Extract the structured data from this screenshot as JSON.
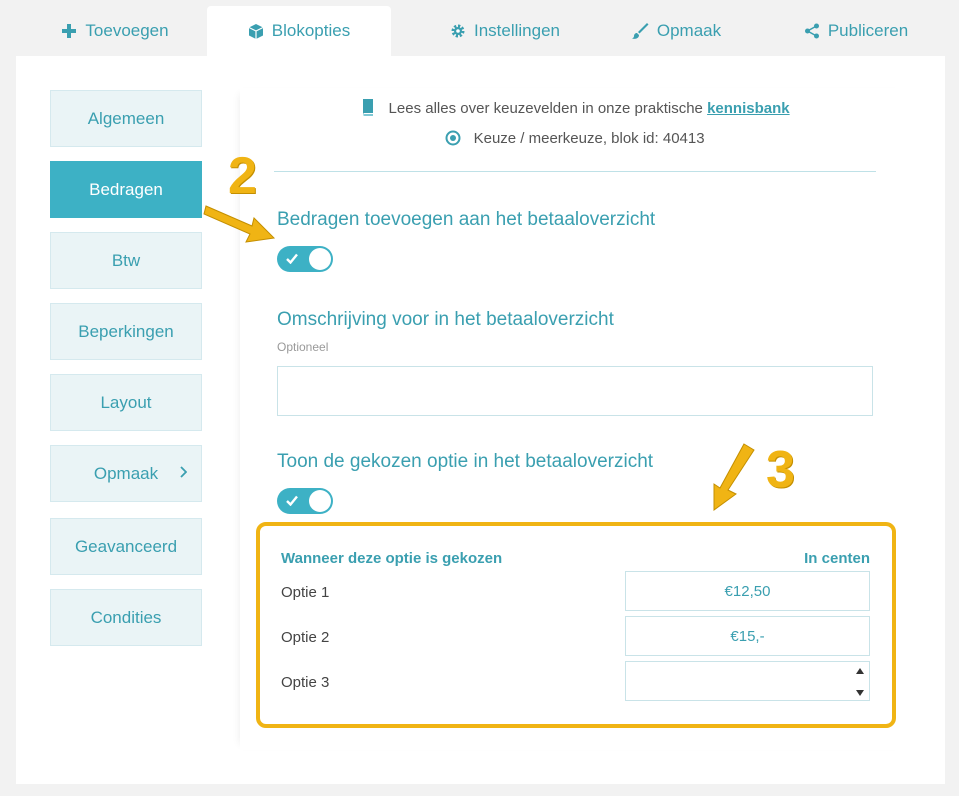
{
  "tabs": [
    {
      "label": "Toevoegen",
      "icon": "plus-icon"
    },
    {
      "label": "Blokopties",
      "icon": "cube-icon",
      "active": true
    },
    {
      "label": "Instellingen",
      "icon": "gear-icon"
    },
    {
      "label": "Opmaak",
      "icon": "brush-icon"
    },
    {
      "label": "Publiceren",
      "icon": "share-icon"
    }
  ],
  "sidebar": {
    "items": [
      {
        "label": "Algemeen"
      },
      {
        "label": "Bedragen",
        "active": true
      },
      {
        "label": "Btw"
      },
      {
        "label": "Beperkingen"
      },
      {
        "label": "Layout"
      },
      {
        "label": "Opmaak",
        "has_submenu": true
      },
      {
        "label": "Geavanceerd"
      },
      {
        "label": "Condities"
      }
    ]
  },
  "info": {
    "kb_text": "Lees alles over keuzevelden in onze praktische",
    "kb_link": "kennisbank",
    "block_type": "Keuze / meerkeuze, blok id: 40413"
  },
  "section_amounts": {
    "title": "Bedragen toevoegen aan het betaaloverzicht",
    "toggle_on": true
  },
  "section_description": {
    "title": "Omschrijving voor in het betaaloverzicht",
    "hint": "Optioneel",
    "value": ""
  },
  "section_show_option": {
    "title": "Toon de gekozen optie in het betaaloverzicht",
    "toggle_on": true
  },
  "options_table": {
    "header_left": "Wanneer deze optie is gekozen",
    "header_right": "In centen",
    "rows": [
      {
        "label": "Optie 1",
        "value": "€12,50"
      },
      {
        "label": "Optie 2",
        "value": "€15,-"
      },
      {
        "label": "Optie 3",
        "value": ""
      }
    ]
  },
  "annotations": {
    "step_2": "2",
    "step_3": "3",
    "color": "#f0b414"
  },
  "colors": {
    "accent": "#3db1c5",
    "accent_text": "#3a9fb0",
    "highlight": "#f0b414"
  }
}
